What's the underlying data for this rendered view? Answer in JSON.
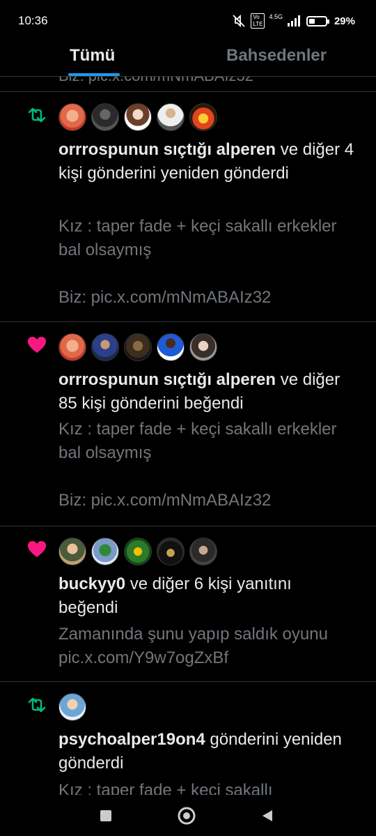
{
  "status_bar": {
    "time": "10:36",
    "network": "4.5G",
    "battery": "29%",
    "battery_level": 0.29,
    "icons": [
      "mute-icon",
      "volte-icon",
      "signal-icon",
      "battery-icon"
    ]
  },
  "tabs": [
    {
      "label": "Tümü",
      "active": true
    },
    {
      "label": "Bahsedenler",
      "active": false
    }
  ],
  "colors": {
    "accent": "#1d9bf0",
    "retweet": "#00ba7c",
    "like": "#f91880",
    "muted": "#71767b",
    "text": "#e7e9ea",
    "divider": "#2f3336"
  },
  "top_clip": {
    "text": "Biz: pic.x.com/mNmABAIz32"
  },
  "notifications": [
    {
      "kind": "retweet",
      "icon": "retweet-icon",
      "user": "orrrospunun sıçtığı alperen",
      "action": " ve diğer 4 kişi gönderini yeniden gönderdi",
      "preview": "Kız : taper fade  + keçi sakallı erkekler bal olsaymış\n\nBiz: pic.x.com/mNmABAIz32"
    },
    {
      "kind": "like",
      "icon": "heart-icon",
      "user": "orrrospunun sıçtığı alperen",
      "action": " ve diğer 85 kişi gönderini beğendi",
      "preview": "Kız : taper fade  + keçi sakallı erkekler bal olsaymış\n\nBiz: pic.x.com/mNmABAIz32"
    },
    {
      "kind": "like",
      "icon": "heart-icon",
      "user": "buckyy0",
      "action": " ve diğer 6 kişi yanıtını beğendi",
      "preview": "Zamanında şunu yapıp saldık oyunu pic.x.com/Y9w7ogZxBf"
    },
    {
      "kind": "retweet",
      "icon": "retweet-icon",
      "user": "psychoalper19on4",
      "action": " gönderini yeniden gönderdi",
      "preview": ""
    }
  ],
  "bottom_clip": {
    "text": "Kız : taper fade  + keçi sakallı"
  },
  "navbar": {
    "icons": [
      "recents-square-icon",
      "home-circle-icon",
      "back-triangle-icon"
    ]
  }
}
